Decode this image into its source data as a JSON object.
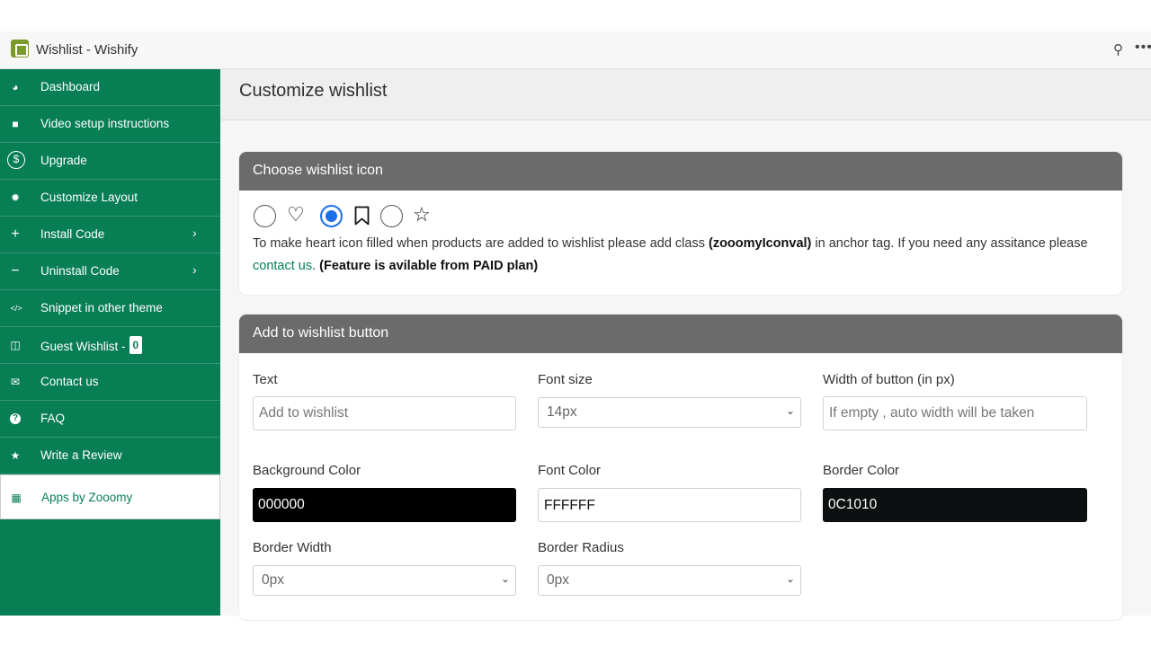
{
  "window": {
    "title": "Wishlist - Wishify",
    "pin_glyph": "⚲",
    "more_glyph": "•••"
  },
  "sidebar": {
    "items": [
      {
        "label": "Dashboard",
        "icon": "dashboard-icon",
        "glyph": "◕"
      },
      {
        "label": "Video setup instructions",
        "icon": "video-icon",
        "glyph": "■"
      },
      {
        "label": "Upgrade",
        "icon": "dollar-icon",
        "glyph": "$"
      },
      {
        "label": "Customize Layout",
        "icon": "gear-icon",
        "glyph": "✹"
      },
      {
        "label": "Install Code",
        "icon": "plus-icon",
        "glyph": "+",
        "chevron": "›"
      },
      {
        "label": "Uninstall Code",
        "icon": "minus-icon",
        "glyph": "−",
        "chevron": "›"
      },
      {
        "label": "Snippet in other theme",
        "icon": "code-icon",
        "glyph": "</>"
      },
      {
        "label": "Guest Wishlist -",
        "icon": "columns-icon",
        "glyph": "◫",
        "badge": "0"
      },
      {
        "label": "Contact us",
        "icon": "envelope-icon",
        "glyph": "✉"
      },
      {
        "label": "FAQ",
        "icon": "question-icon",
        "glyph": "?"
      },
      {
        "label": "Write a Review",
        "icon": "star-icon",
        "glyph": "★"
      },
      {
        "label": "Apps by Zooomy",
        "icon": "grid-icon",
        "glyph": "▦"
      }
    ]
  },
  "page": {
    "title": "Customize wishlist"
  },
  "icon_card": {
    "title": "Choose wishlist icon",
    "options": [
      {
        "icon": "heart-outline-icon",
        "glyph": "♡",
        "selected": false
      },
      {
        "icon": "bookmark-icon",
        "glyph": "🔖",
        "selected": true
      },
      {
        "icon": "star-outline-icon",
        "glyph": "☆",
        "selected": false
      }
    ],
    "note_part1": "To make heart icon filled when products are added to wishlist please add class",
    "note_class": "(zooomyIconval)",
    "note_part2": "in anchor tag. If you need any assitance please",
    "note_link": "contact us",
    "note_part3": ".",
    "note_bold": "(Feature is avilable from PAID plan)"
  },
  "button_card": {
    "title": "Add to wishlist button",
    "text_label": "Text",
    "text_placeholder": "Add to wishlist",
    "font_size_label": "Font size",
    "font_size_value": "14px",
    "width_label": "Width of button (in px)",
    "width_placeholder": "If empty , auto width will be taken",
    "bg_color_label": "Background Color",
    "bg_color_value": "000000",
    "font_color_label": "Font Color",
    "font_color_value": "FFFFFF",
    "border_color_label": "Border Color",
    "border_color_value": "0C1010",
    "border_width_label": "Border Width",
    "border_width_value": "0px",
    "border_radius_label": "Border Radius",
    "border_radius_value": "0px"
  },
  "colors": {
    "sidebar": "#087e55",
    "header_bar": "#6b6b6b",
    "accent": "#1c6fe8"
  }
}
